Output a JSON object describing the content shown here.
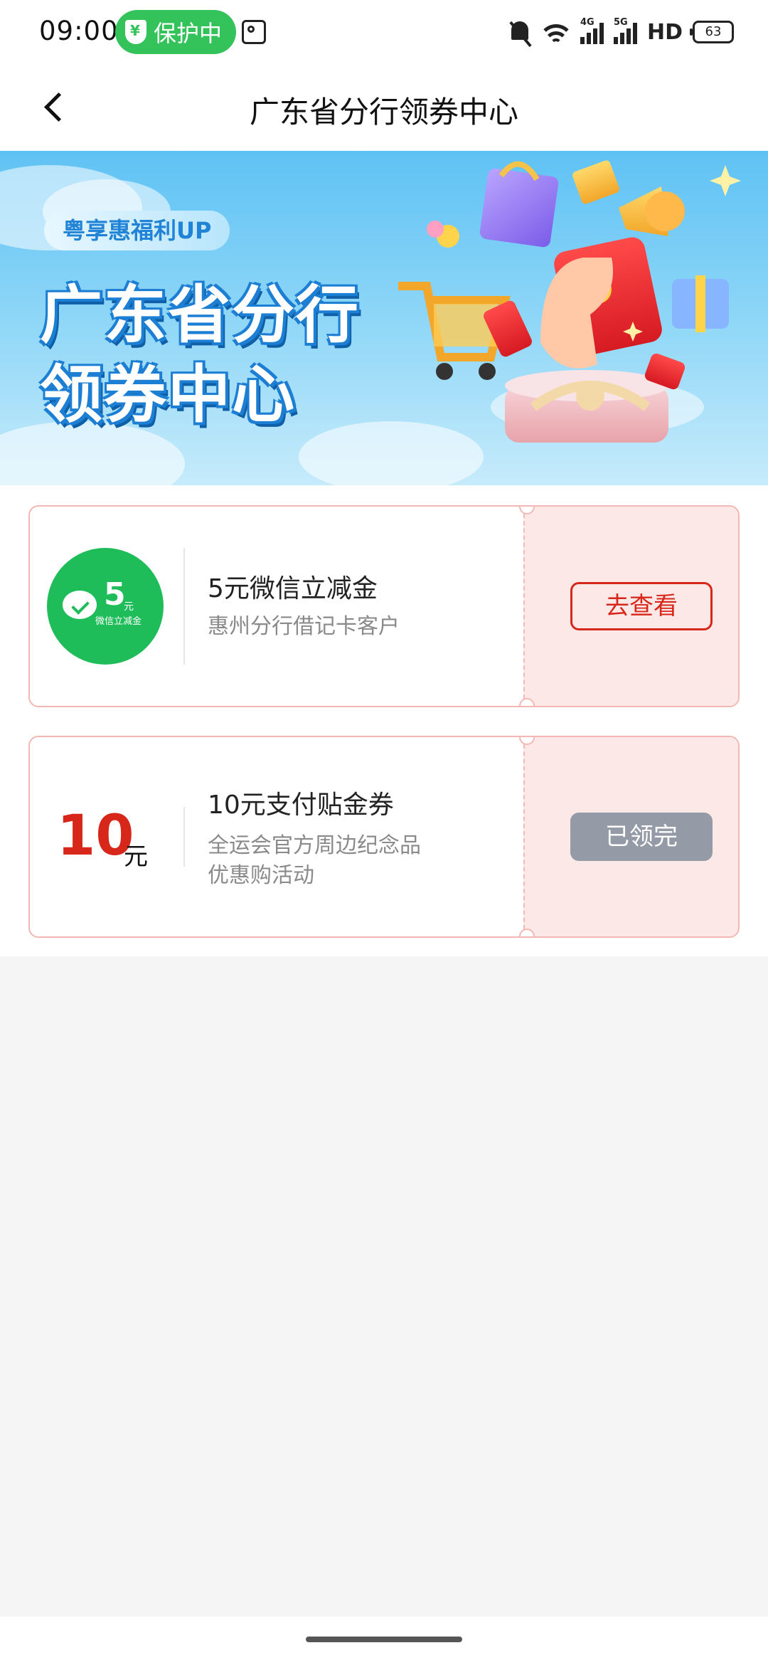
{
  "status_bar": {
    "time": "09:00",
    "protect_label": "保护中",
    "network_labels": [
      "4G",
      "5G"
    ],
    "hd_label": "HD",
    "battery": "63"
  },
  "nav": {
    "back_icon": "chevron-left-icon",
    "title": "广东省分行领券中心"
  },
  "banner": {
    "tag": "粤享惠福利UP",
    "title_line1": "广东省分行",
    "title_line2": "领券中心"
  },
  "coupons": [
    {
      "badge_amount": "5",
      "badge_unit": "元",
      "badge_sub": "微信立减金",
      "title": "5元微信立减金",
      "desc": "惠州分行借记卡客户",
      "button": "去查看",
      "status": "available",
      "accent": "#d7261a"
    },
    {
      "amount": "10",
      "unit": "元",
      "title": "10元支付贴金券",
      "desc_line1": "全运会官方周边纪念品",
      "desc_line2": "优惠购活动",
      "button": "已领完",
      "status": "sold-out",
      "accent": "#949aa6"
    }
  ],
  "colors": {
    "brand_green": "#34c25a",
    "wechat_green": "#1ebd5a",
    "coupon_red": "#d7261a",
    "stub_pink": "#fde8e8",
    "banner_blue": "#5fc2f4"
  }
}
